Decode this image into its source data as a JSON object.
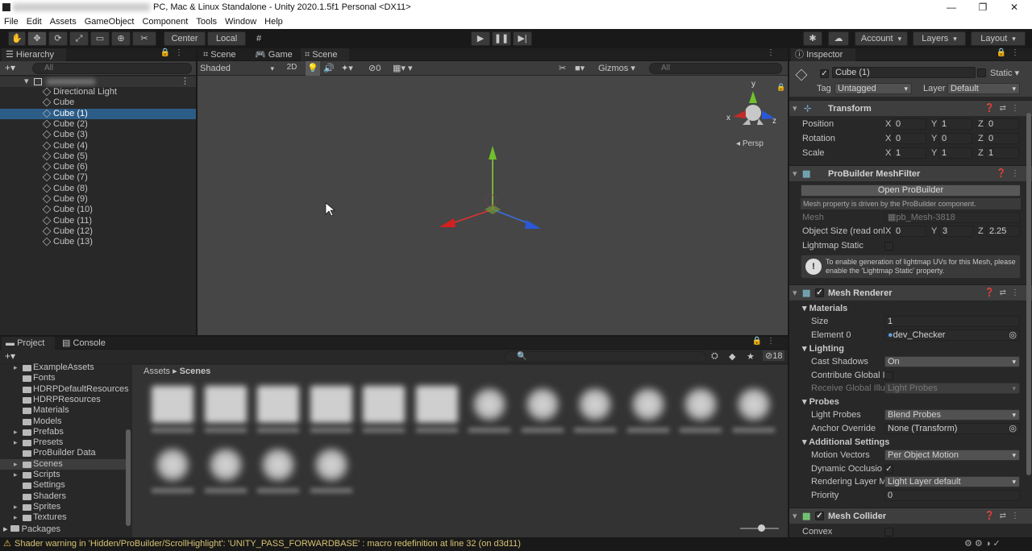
{
  "window": {
    "title": "PC, Mac & Linux Standalone - Unity 2020.1.5f1 Personal <DX11>",
    "colors": {
      "accent": "#2c5d87",
      "background": "#282828",
      "warning": "#d8c272"
    }
  },
  "menu": [
    "File",
    "Edit",
    "Assets",
    "GameObject",
    "Component",
    "Tools",
    "Window",
    "Help"
  ],
  "toolbar": {
    "center_label": "Center",
    "local_label": "Local",
    "account_label": "Account",
    "layers_label": "Layers",
    "layout_label": "Layout"
  },
  "hierarchy": {
    "tab": "Hierarchy",
    "search_placeholder": "All",
    "items": [
      "Directional Light",
      "Cube",
      "Cube (1)",
      "Cube (2)",
      "Cube (3)",
      "Cube (4)",
      "Cube (5)",
      "Cube (6)",
      "Cube (7)",
      "Cube (8)",
      "Cube (9)",
      "Cube (10)",
      "Cube (11)",
      "Cube (12)",
      "Cube (13)"
    ],
    "selected_index": 2
  },
  "scene": {
    "tabs": [
      "Scene",
      "Game",
      "Scene"
    ],
    "shading": "Shaded",
    "mode_2d": "2D",
    "hidden_count": "0",
    "gizmos": "Gizmos",
    "search_placeholder": "All",
    "persp": "Persp",
    "axis_x": "x",
    "axis_y": "y",
    "axis_z": "z"
  },
  "project": {
    "tabs": [
      "Project",
      "Console"
    ],
    "folders": [
      "ExampleAssets",
      "Fonts",
      "HDRPDefaultResources",
      "HDRPResources",
      "Materials",
      "Models",
      "Prefabs",
      "Presets",
      "ProBuilder Data",
      "Scenes",
      "Scripts",
      "Settings",
      "Shaders",
      "Sprites",
      "Textures"
    ],
    "selected_folder": "Scenes",
    "packages": "Packages",
    "breadcrumb": [
      "Assets",
      "Scenes"
    ],
    "hidden_count": "18"
  },
  "inspector": {
    "tab": "Inspector",
    "object_name": "Cube (1)",
    "static_label": "Static",
    "tag_label": "Tag",
    "tag_value": "Untagged",
    "layer_label": "Layer",
    "layer_value": "Default",
    "transform": {
      "title": "Transform",
      "rows": [
        {
          "label": "Position",
          "x": "0",
          "y": "1",
          "z": "0"
        },
        {
          "label": "Rotation",
          "x": "0",
          "y": "0",
          "z": "0"
        },
        {
          "label": "Scale",
          "x": "1",
          "y": "1",
          "z": "1"
        }
      ]
    },
    "meshfilter": {
      "title": "ProBuilder MeshFilter",
      "open_button": "Open ProBuilder",
      "note": "Mesh property is driven by the ProBuilder component.",
      "mesh_label": "Mesh",
      "mesh_value": "pb_Mesh-3818",
      "size_label": "Object Size (read onl",
      "size_x": "0",
      "size_y": "3",
      "size_z": "2.25",
      "lightmap_label": "Lightmap Static",
      "help": "To enable generation of lightmap UVs for this Mesh, please enable the 'Lightmap Static' property."
    },
    "renderer": {
      "title": "Mesh Renderer",
      "materials": "Materials",
      "size_label": "Size",
      "size_value": "1",
      "element_label": "Element 0",
      "element_value": "dev_Checker",
      "lighting": "Lighting",
      "cast_label": "Cast Shadows",
      "cast_value": "On",
      "contribute_label": "Contribute Global I",
      "receive_label": "Receive Global Illu",
      "receive_value": "Light Probes",
      "probes": "Probes",
      "lightprobes_label": "Light Probes",
      "lightprobes_value": "Blend Probes",
      "anchor_label": "Anchor Override",
      "anchor_value": "None (Transform)",
      "additional": "Additional Settings",
      "motion_label": "Motion Vectors",
      "motion_value": "Per Object Motion",
      "dynamic_label": "Dynamic Occlusio",
      "rendering_label": "Rendering Layer M",
      "rendering_value": "Light Layer default",
      "priority_label": "Priority",
      "priority_value": "0"
    },
    "collider": {
      "title": "Mesh Collider",
      "convex_label": "Convex"
    }
  },
  "status": {
    "message": "Shader warning in 'Hidden/ProBuilder/ScrollHighlight': 'UNITY_PASS_FORWARDBASE' : macro redefinition at line 32 (on d3d11)"
  }
}
